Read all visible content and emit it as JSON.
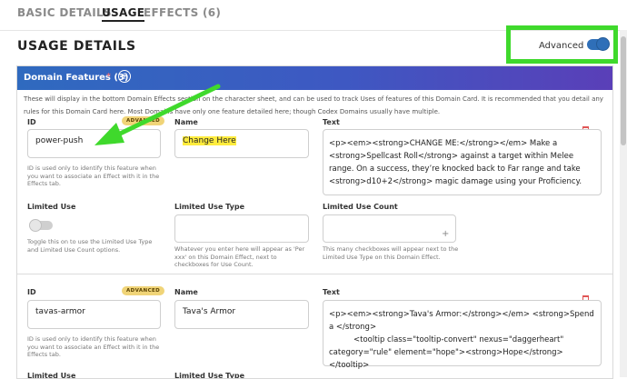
{
  "tabs": [
    {
      "label": "BASIC DETAILS"
    },
    {
      "label": "USAGE"
    },
    {
      "label": "EFFECTS (6)"
    }
  ],
  "page_title": "USAGE DETAILS",
  "advanced_label": "Advanced",
  "domain_features": {
    "title": "Domain Features (3)",
    "star": "*",
    "description": "These will display in the bottom Domain Effects section on the character sheet, and can be used to track Uses of features of this Domain Card. It is recommended that you detail any rules for this Domain Card here. Most Domains have only one feature detailed here; though Codex Domains usually have multiple."
  },
  "feature1": {
    "id_label": "ID",
    "advanced_badge": "ADVANCED",
    "id_value": "power-push",
    "id_hint": "ID is used only to identify this feature when you want to associate an Effect with it in the Effects tab.",
    "name_label": "Name",
    "name_value": "Change Here",
    "text_label": "Text",
    "text_value": "<p><em><strong>CHANGE ME:</strong></em> Make a <strong>Spellcast Roll</strong> against a target within Melee range. On a success, they’re knocked back to Far range and take <strong>d10+2</strong> magic damage using your Proficiency.",
    "limited_use_label": "Limited Use",
    "limited_use_hint": "Toggle this on to use the Limited Use Type and Limited Use Count options.",
    "limited_use_type_label": "Limited Use Type",
    "limited_use_type_hint": "Whatever you enter here will appear as 'Per xxx' on this Domain Effect, next to checkboxes for Use Count.",
    "limited_use_count_label": "Limited Use Count",
    "limited_use_count_hint": "This many checkboxes will appear next to the Limited Use Type on this Domain Effect."
  },
  "feature2": {
    "id_label": "ID",
    "advanced_badge": "ADVANCED",
    "id_value": "tavas-armor",
    "id_hint": "ID is used only to identify this feature when you want to associate an Effect with it in the Effects tab.",
    "name_label": "Name",
    "name_value": "Tava's Armor",
    "text_label": "Text",
    "text_value": "<p><em><strong>Tava's Armor:</strong></em> <strong>Spend a </strong>\n          <tooltip class=\"tooltip-convert\" nexus=\"daggerheart\" category=\"rule\" element=\"hope\"><strong>Hope</strong></tooltip>",
    "limited_use_label": "Limited Use",
    "limited_use_type_label": "Limited Use Type"
  },
  "colors": {
    "accent_green": "#3fd92c",
    "highlight_yellow": "#ffec3d",
    "header_blue": "#2f6abf",
    "header_purple": "#5a3fb8",
    "toggle_blue": "#2f6fb8",
    "badge_gold": "#f0d478"
  },
  "icons": [
    "plus-circle-icon",
    "trash-icon",
    "plus-icon",
    "green-arrow-annotation"
  ]
}
